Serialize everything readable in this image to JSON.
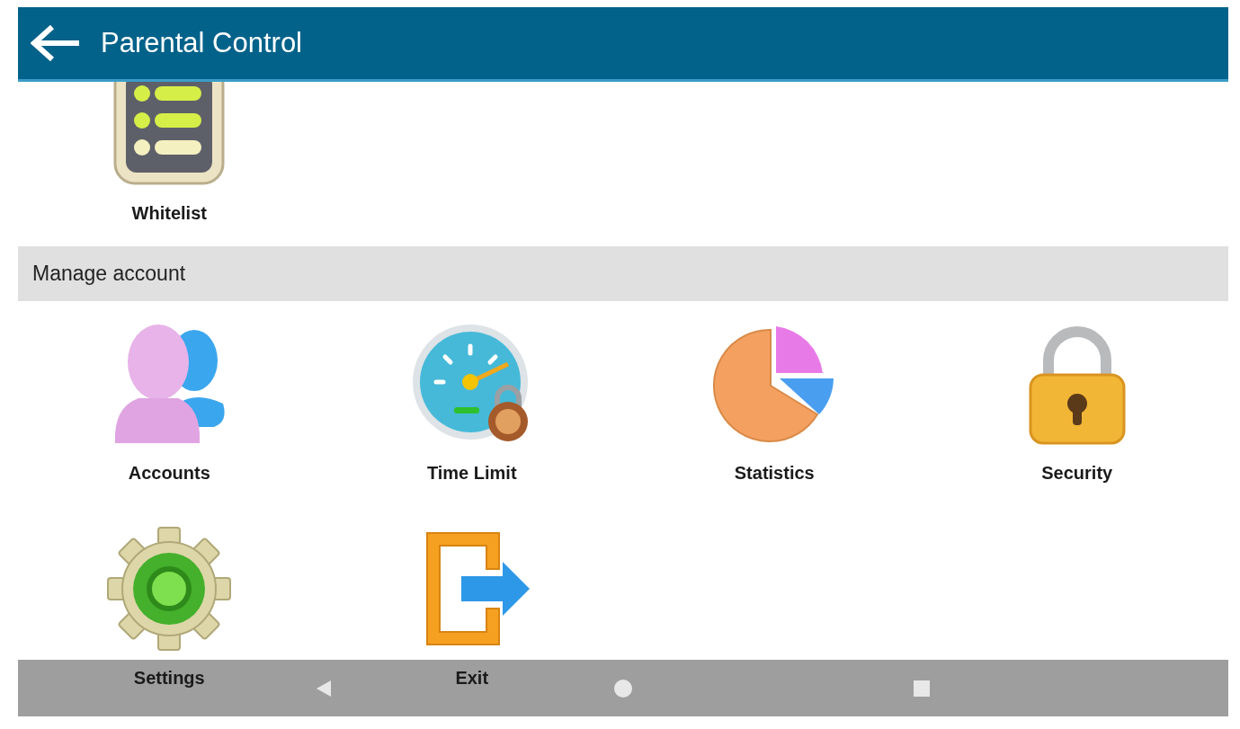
{
  "header": {
    "title": "Parental Control"
  },
  "sections": [
    {
      "items": [
        {
          "label": "Whitelist",
          "kind": "whitelist"
        }
      ]
    },
    {
      "title": "Manage account",
      "items": [
        {
          "label": "Accounts",
          "kind": "accounts"
        },
        {
          "label": "Time Limit",
          "kind": "timelimit"
        },
        {
          "label": "Statistics",
          "kind": "statistics"
        },
        {
          "label": "Security",
          "kind": "security"
        },
        {
          "label": "Settings",
          "kind": "settings"
        },
        {
          "label": "Exit",
          "kind": "exit"
        }
      ]
    }
  ]
}
